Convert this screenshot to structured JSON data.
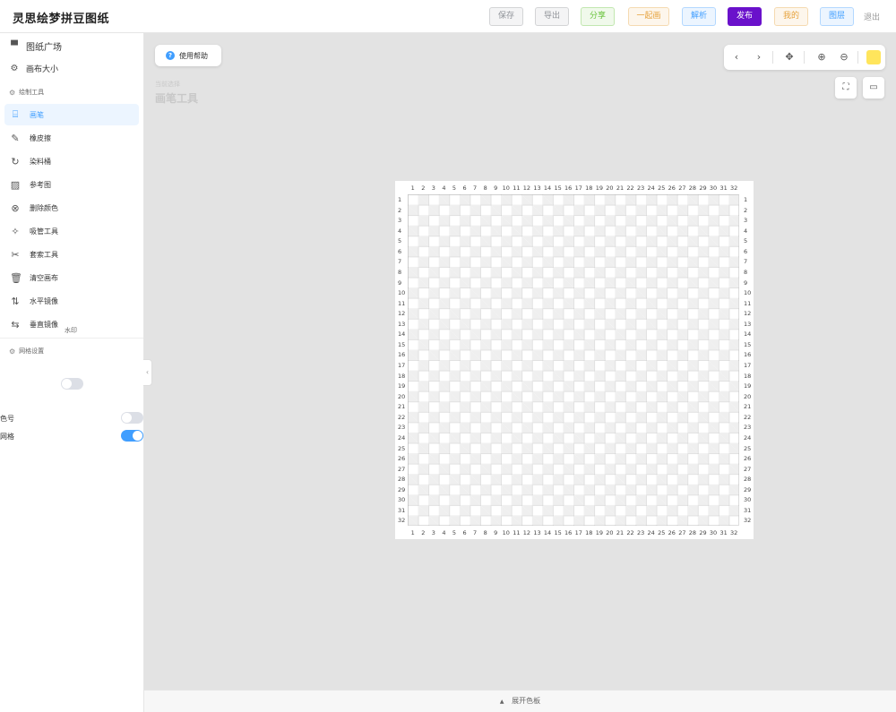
{
  "app": {
    "title": "灵思绘梦拼豆图纸"
  },
  "header": {
    "save": "保存",
    "export": "导出",
    "share": "分享",
    "together": "一起画",
    "parse": "解析",
    "publish": "发布",
    "mine": "我的",
    "layers": "图层",
    "exit": "退出"
  },
  "sidebar": {
    "plaza": "图纸广场",
    "canvas_size": "画布大小",
    "tools_section": "绘制工具",
    "tools": [
      {
        "label": "画笔",
        "icon": "brush-icon",
        "glyph": "⌸"
      },
      {
        "label": "橡皮擦",
        "icon": "eraser-icon",
        "glyph": "✎"
      },
      {
        "label": "染料桶",
        "icon": "bucket-icon",
        "glyph": "↻"
      },
      {
        "label": "参考图",
        "icon": "image-icon",
        "glyph": "▨"
      },
      {
        "label": "删除颜色",
        "icon": "delete-color-icon",
        "glyph": "⊗"
      },
      {
        "label": "吸管工具",
        "icon": "eyedropper-icon",
        "glyph": "✧"
      },
      {
        "label": "套索工具",
        "icon": "lasso-icon",
        "glyph": "✂"
      },
      {
        "label": "清空画布",
        "icon": "trash-icon",
        "glyph": "🗑"
      },
      {
        "label": "水平镜像",
        "icon": "flip-horizontal-icon",
        "glyph": "⇅"
      },
      {
        "label": "垂直镜像",
        "icon": "flip-vertical-icon",
        "glyph": "⇆"
      }
    ],
    "grid_section": "网格设置",
    "watermark": "水印",
    "color_code": "色号",
    "grid": "网格"
  },
  "main": {
    "help": "使用帮助",
    "current_selection_label": "当前选择",
    "current_selection_value": "画笔工具",
    "current_color": "#ffe55c"
  },
  "footer": {
    "expand_palette": "展开色板"
  }
}
